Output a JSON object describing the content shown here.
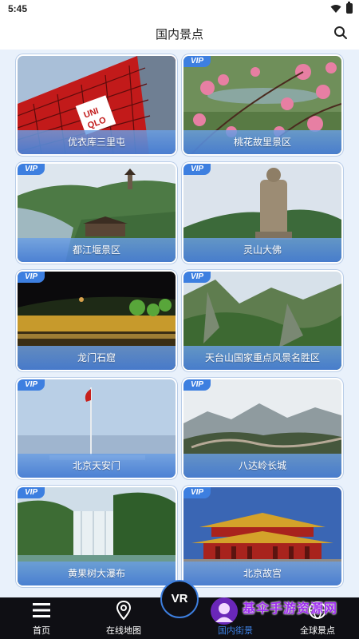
{
  "status_bar": {
    "time": "5:45"
  },
  "header": {
    "title": "国内景点"
  },
  "attractions": [
    {
      "name": "优衣库三里屯",
      "vip": false
    },
    {
      "name": "桃花故里景区",
      "vip": true
    },
    {
      "name": "都江堰景区",
      "vip": true
    },
    {
      "name": "灵山大佛",
      "vip": true
    },
    {
      "name": "龙门石窟",
      "vip": true
    },
    {
      "name": "天台山国家重点风景名胜区",
      "vip": true
    },
    {
      "name": "北京天安门",
      "vip": true
    },
    {
      "name": "八达岭长城",
      "vip": true
    },
    {
      "name": "黄果树大瀑布",
      "vip": true
    },
    {
      "name": "北京故宫",
      "vip": true
    }
  ],
  "vip_label": "VIP",
  "nav": {
    "home": "首页",
    "online_map": "在线地图",
    "vr": "VR",
    "domestic": "国内街景",
    "global": "全球景点"
  },
  "watermark": {
    "text": "基伞手游资源网"
  },
  "colors": {
    "accent": "#3d7fe0",
    "nav_bg": "#0f0f14",
    "page_bg": "#e9f1fb"
  }
}
